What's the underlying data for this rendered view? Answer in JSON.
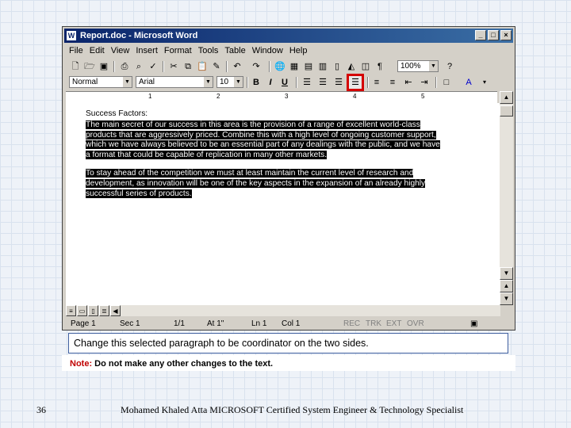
{
  "window": {
    "title": "Report.doc - Microsoft Word",
    "buttons": {
      "minimize": "_",
      "maximize": "□",
      "close": "×"
    }
  },
  "menu": [
    "File",
    "Edit",
    "View",
    "Insert",
    "Format",
    "Tools",
    "Table",
    "Window",
    "Help"
  ],
  "toolbar": {
    "zoom": "100%",
    "style": "Normal",
    "font": "Arial",
    "size": "10",
    "bold": "B",
    "italic": "I",
    "underline": "U"
  },
  "ruler": {
    "marks": [
      "1",
      "2",
      "3",
      "4",
      "5"
    ]
  },
  "document": {
    "heading": "Success Factors:",
    "paragraph1_lines": [
      "The main secret of our success in this area is the provision of a range of excellent world-class",
      "products that are aggressively priced. Combine this with a high level of ongoing customer support,",
      "which we have always believed to be an essential part of any dealings with the public, and we have",
      "a format that could be capable of replication in many other markets."
    ],
    "paragraph2_lines": [
      "To stay ahead of the competition we must at least maintain the current level of research and",
      "development, as innovation will be one of the key aspects in the expansion of an already highly",
      "successful series of products."
    ]
  },
  "statusbar": {
    "page": "Page 1",
    "sec": "Sec 1",
    "pages": "1/1",
    "at": "At 1\"",
    "ln": "Ln 1",
    "col": "Col 1",
    "rec": "REC",
    "trk": "TRK",
    "ext": "EXT",
    "ovr": "OVR"
  },
  "instruction": "Change this selected paragraph to be coordinator on the two sides.",
  "note": {
    "label": "Note:",
    "text": "Do not make any other changes to the text."
  },
  "footer": {
    "page_number": "36",
    "author": "Mohamed Khaled Atta MICROSOFT Certified System Engineer & Technology Specialist"
  },
  "colors": {
    "highlight": "#d40000",
    "titlebar": "#0a246a",
    "note_label": "#c00000"
  }
}
